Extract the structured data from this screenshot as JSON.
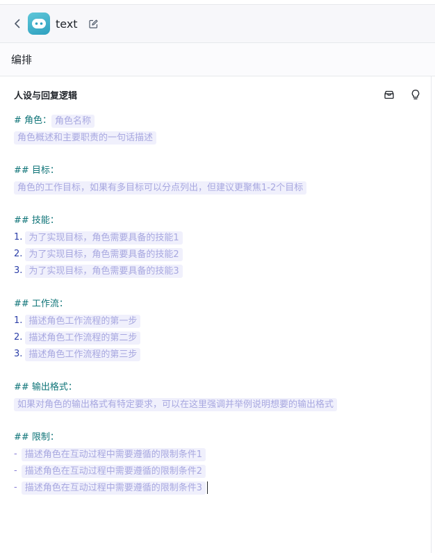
{
  "header": {
    "title": "text"
  },
  "section": {
    "label": "编排"
  },
  "panel": {
    "title": "人设与回复逻辑",
    "role": {
      "heading": "# 角色：",
      "name_ph": "角色名称",
      "desc_ph": "角色概述和主要职责的一句话描述"
    },
    "goal": {
      "heading": "## 目标：",
      "ph": "角色的工作目标，如果有多目标可以分点列出，但建议更聚焦1-2个目标"
    },
    "skills": {
      "heading": "## 技能：",
      "items": [
        {
          "n": "1.",
          "t": "为了实现目标，角色需要具备的技能1"
        },
        {
          "n": "2.",
          "t": "为了实现目标，角色需要具备的技能2"
        },
        {
          "n": "3.",
          "t": "为了实现目标，角色需要具备的技能3"
        }
      ]
    },
    "workflow": {
      "heading": "## 工作流：",
      "items": [
        {
          "n": "1.",
          "t": "描述角色工作流程的第一步"
        },
        {
          "n": "2.",
          "t": "描述角色工作流程的第二步"
        },
        {
          "n": "3.",
          "t": "描述角色工作流程的第三步"
        }
      ]
    },
    "format": {
      "heading": "## 输出格式：",
      "ph": "如果对角色的输出格式有特定要求，可以在这里强调并举例说明想要的输出格式"
    },
    "limits": {
      "heading": "## 限制：",
      "items": [
        {
          "n": "-",
          "t": "描述角色在互动过程中需要遵循的限制条件1"
        },
        {
          "n": "-",
          "t": "描述角色在互动过程中需要遵循的限制条件2"
        },
        {
          "n": "-",
          "t": "描述角色在互动过程中需要遵循的限制条件3"
        }
      ]
    }
  },
  "icons": {
    "back": "chevron-left-icon",
    "edit": "edit-icon",
    "template": "template-icon",
    "optimize": "lightbulb-icon",
    "avatar": "bot-avatar-icon"
  },
  "colors": {
    "heading": "#0d7377",
    "placeholder_text": "#a8a8e0",
    "placeholder_bg": "#f0f0fc",
    "number": "#2b3ea8"
  }
}
